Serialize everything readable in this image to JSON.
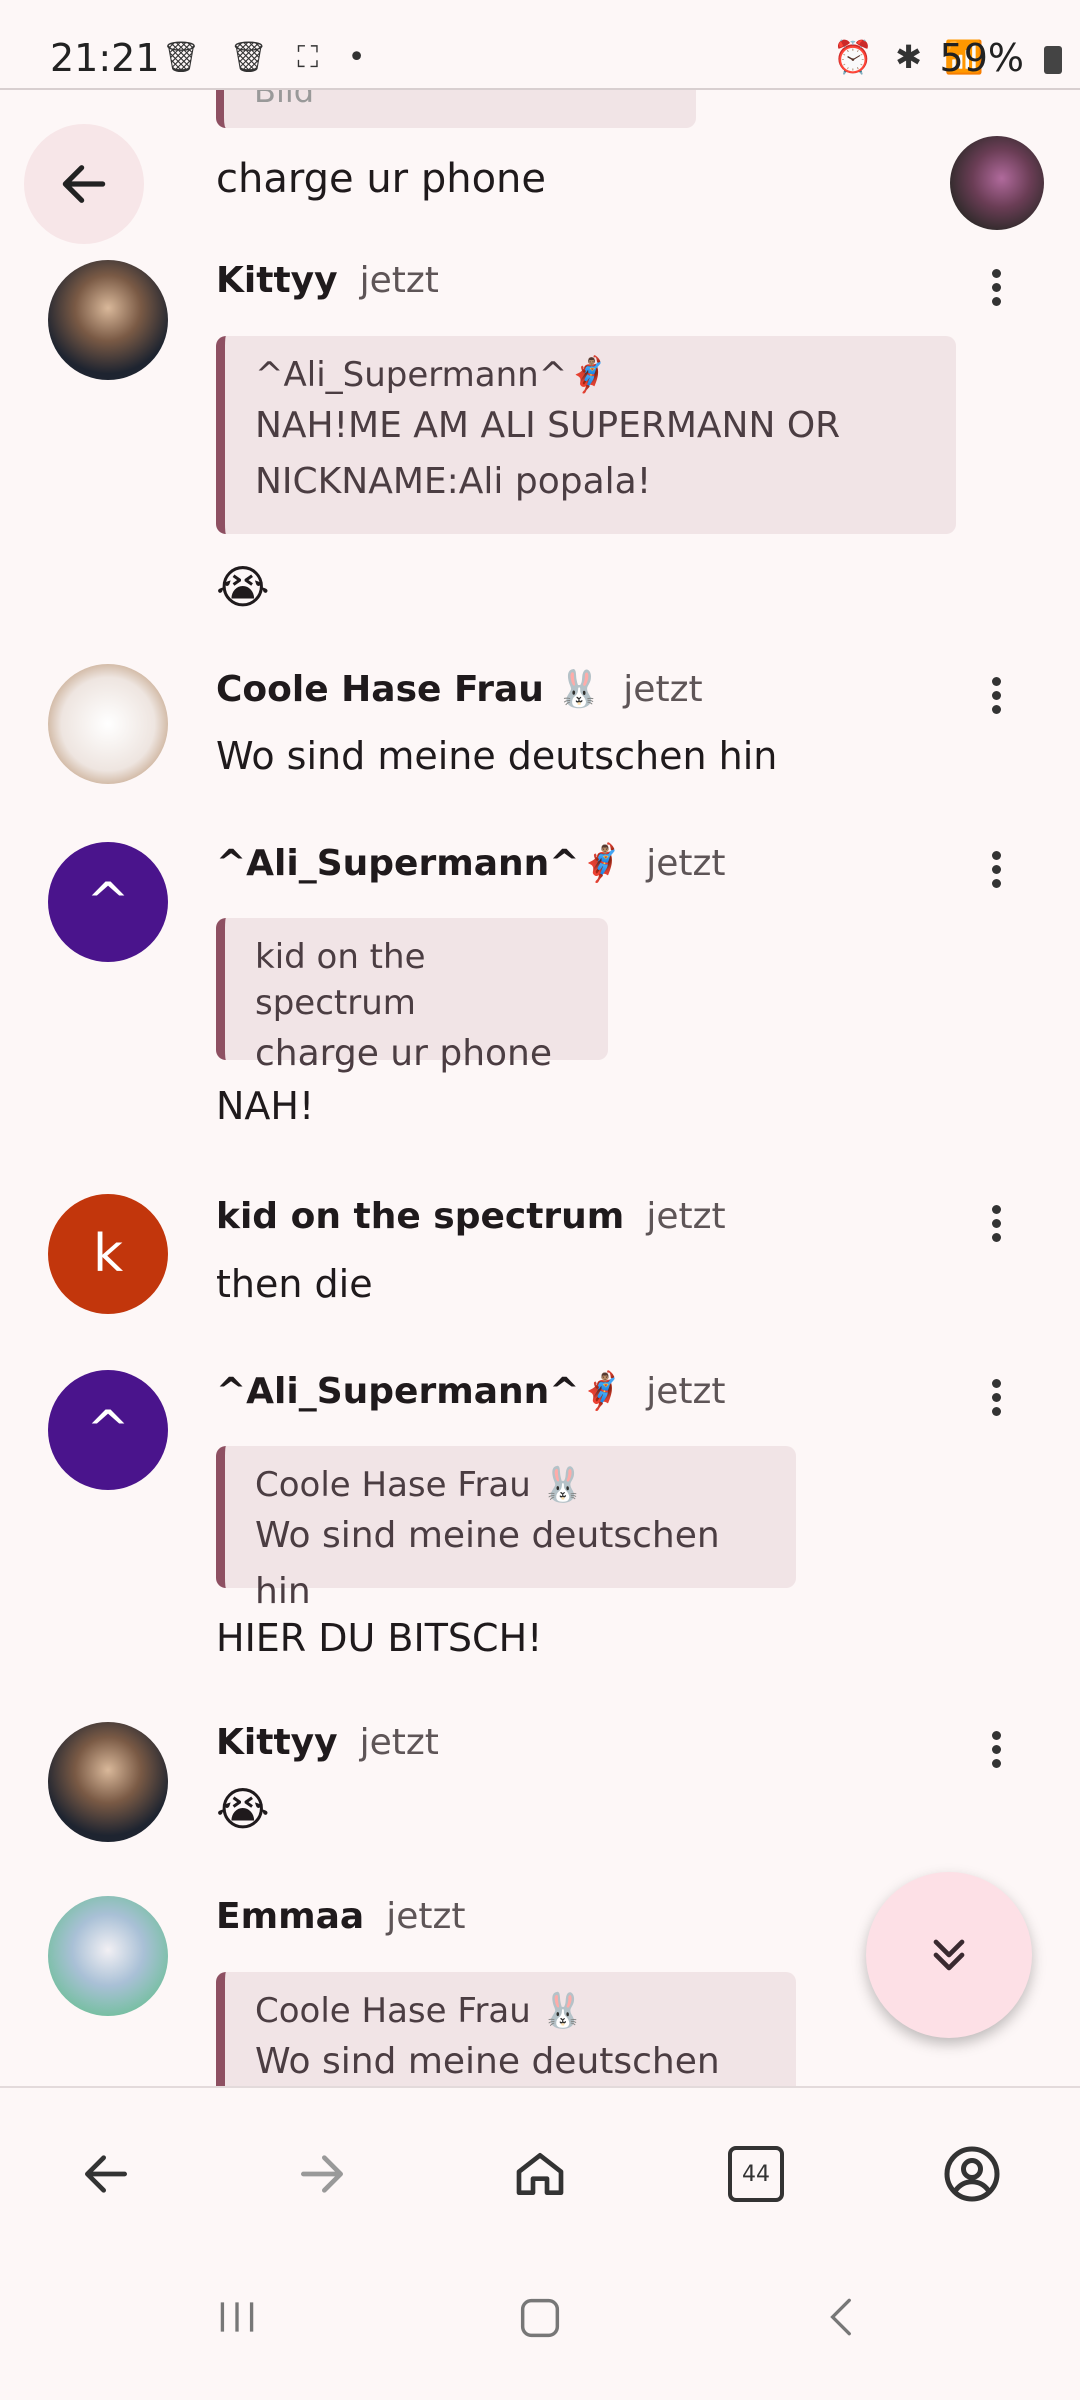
{
  "status_bar": {
    "time": "21:21",
    "battery": "59%",
    "left_icons": "🗑 🗑 ⛶ •",
    "right_icons": "⏰ ✱ 📶"
  },
  "top_partial": {
    "text": "Bild"
  },
  "pinned": {
    "text": "charge ur phone"
  },
  "messages": [
    {
      "author": "Kittyy",
      "time": "jetzt",
      "quote_author": "^Ali_Supermann^🦸🏽‍♂️",
      "quote_text": "NAH!ME AM ALI SUPERMANN OR NICKNAME:Ali popala!",
      "body": "😭"
    },
    {
      "author": "Coole Hase Frau 🐰",
      "time": "jetzt",
      "body": "Wo sind meine deutschen hin"
    },
    {
      "author": "^Ali_Supermann^🦸🏽‍♂️",
      "time": "jetzt",
      "avatar_letter": "^",
      "quote_author": "kid on the spectrum",
      "quote_text": "charge ur phone",
      "body": "NAH!"
    },
    {
      "author": "kid on the spectrum",
      "time": "jetzt",
      "avatar_letter": "k",
      "body": "then die"
    },
    {
      "author": "^Ali_Supermann^🦸🏽‍♂️",
      "time": "jetzt",
      "avatar_letter": "^",
      "quote_author": "Coole Hase Frau 🐰",
      "quote_text": "Wo sind meine deutschen hin",
      "body": "HIER DU BITSCH!"
    },
    {
      "author": "Kittyy",
      "time": "jetzt",
      "body": "😭"
    },
    {
      "author": "Emmaa",
      "time": "jetzt",
      "quote_author": "Coole Hase Frau 🐰",
      "quote_text": "Wo sind meine deutschen hin"
    }
  ],
  "browser": {
    "tab_count": "44"
  },
  "colors": {
    "accent": "#8e5062",
    "quote_bg": "#f1e4e6",
    "purple_avatar": "#4a148c",
    "orange_avatar": "#c2360c",
    "fab_bg": "#fde0e6"
  }
}
